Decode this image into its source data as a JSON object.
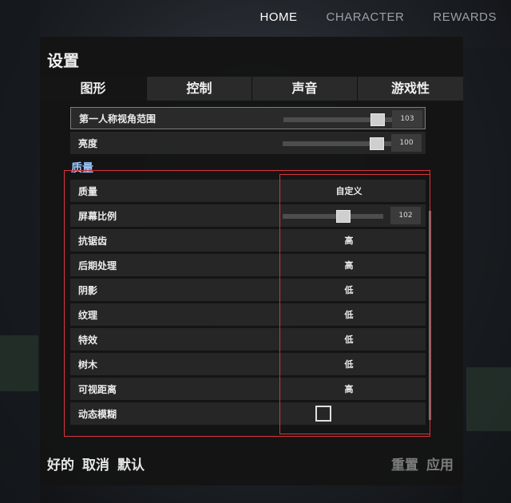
{
  "topnav": {
    "items": [
      {
        "label": "HOME",
        "active": true
      },
      {
        "label": "CHARACTER",
        "active": false
      },
      {
        "label": "REWARDS",
        "active": false
      }
    ]
  },
  "panel": {
    "title": "设置",
    "tabs": [
      {
        "label": "图形",
        "active": true
      },
      {
        "label": "控制",
        "active": false
      },
      {
        "label": "声音",
        "active": false
      },
      {
        "label": "游戏性",
        "active": false
      }
    ]
  },
  "settings_top": [
    {
      "label": "第一人称视角范围",
      "type": "slider",
      "value": "103",
      "level": 0.92
    },
    {
      "label": "亮度",
      "type": "slider",
      "value": "100",
      "level": 0.92
    }
  ],
  "section": {
    "label": "质量"
  },
  "settings_quality": [
    {
      "label": "质量",
      "type": "choice",
      "value": "自定义"
    },
    {
      "label": "屏幕比例",
      "type": "slider",
      "value": "102",
      "level": 0.62
    },
    {
      "label": "抗锯齿",
      "type": "choice",
      "value": "高"
    },
    {
      "label": "后期处理",
      "type": "choice",
      "value": "高"
    },
    {
      "label": "阴影",
      "type": "choice",
      "value": "低"
    },
    {
      "label": "纹理",
      "type": "choice",
      "value": "低"
    },
    {
      "label": "特效",
      "type": "choice",
      "value": "低"
    },
    {
      "label": "树木",
      "type": "choice",
      "value": "低"
    },
    {
      "label": "可视距离",
      "type": "choice",
      "value": "高"
    },
    {
      "label": "动态模糊",
      "type": "checkbox",
      "checked": false
    }
  ],
  "footer": {
    "left": [
      "好的",
      "取消",
      "默认"
    ],
    "right": [
      "重置",
      "应用"
    ]
  },
  "colors": {
    "section_heading": "#9cc6ff",
    "highlight_box": "#d9343d",
    "panel_bg": "#141414",
    "row_bg": "#262626"
  }
}
